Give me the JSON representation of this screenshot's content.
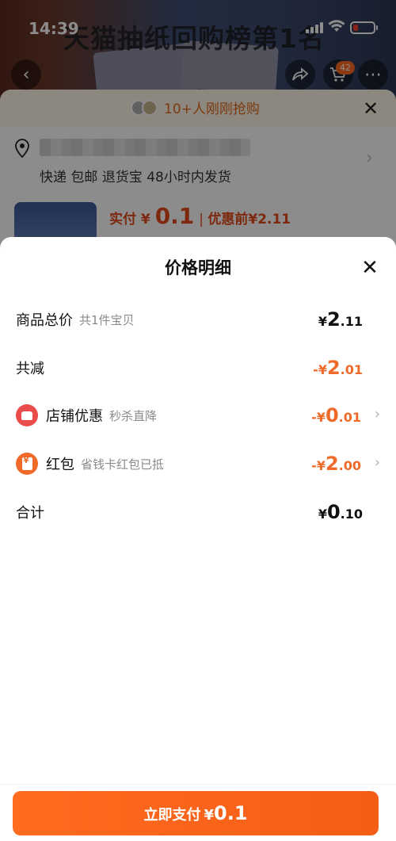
{
  "status_bar": {
    "time": "14:39"
  },
  "background": {
    "product_title": "天猫抽纸回购榜第1名",
    "cart_badge": "42",
    "hurry_text": "10+人刚刚抢购",
    "delivery_text": "快递 包邮 退货宝 48小时内发货",
    "price_label": "实付",
    "price_currency": "¥",
    "price_value": "0.1",
    "price_before": "优惠前¥2.11"
  },
  "sheet": {
    "title": "价格明细",
    "rows": [
      {
        "label": "商品总价",
        "sub": "共1件宝贝",
        "currency": "¥",
        "int": "2",
        "dec": ".11"
      },
      {
        "label": "共减",
        "sub": "",
        "currency": "-¥",
        "int": "2",
        "dec": ".01"
      },
      {
        "label": "店铺优惠",
        "sub": "秒杀直降",
        "currency": "-¥",
        "int": "0",
        "dec": ".01",
        "icon": "store-icon"
      },
      {
        "label": "红包",
        "sub": "省钱卡红包已抵",
        "currency": "-¥",
        "int": "2",
        "dec": ".00",
        "icon": "red-envelope-icon"
      },
      {
        "label": "合计",
        "sub": "",
        "currency": "¥",
        "int": "0",
        "dec": ".10"
      }
    ]
  },
  "pay_button": {
    "text": "立即支付",
    "currency": "¥",
    "value": "0.1"
  },
  "colors": {
    "accent": "#f06a2a",
    "button": "#f45d16",
    "store_icon": "#ea4b4b"
  }
}
